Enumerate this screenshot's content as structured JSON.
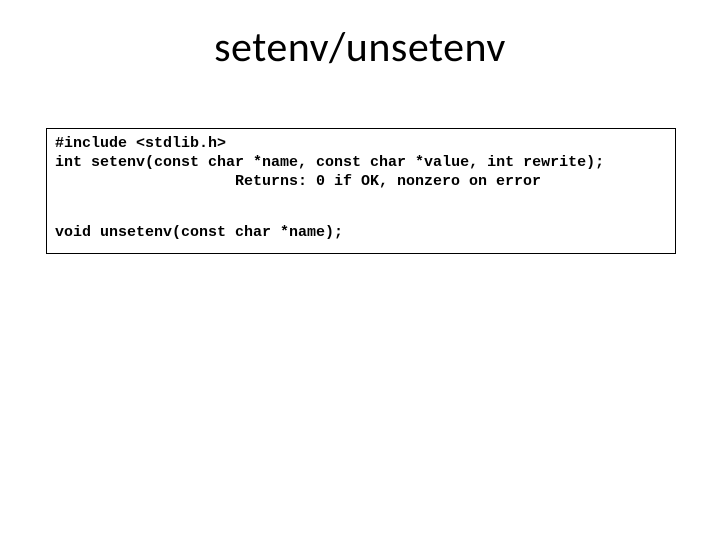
{
  "title": "setenv/unsetenv",
  "code": {
    "include": "#include <stdlib.h>",
    "setenv_decl": "int setenv(const char *name, const char *value, int rewrite);",
    "returns": "Returns: 0 if OK, nonzero on error",
    "unsetenv_decl": "void unsetenv(const char *name);"
  }
}
